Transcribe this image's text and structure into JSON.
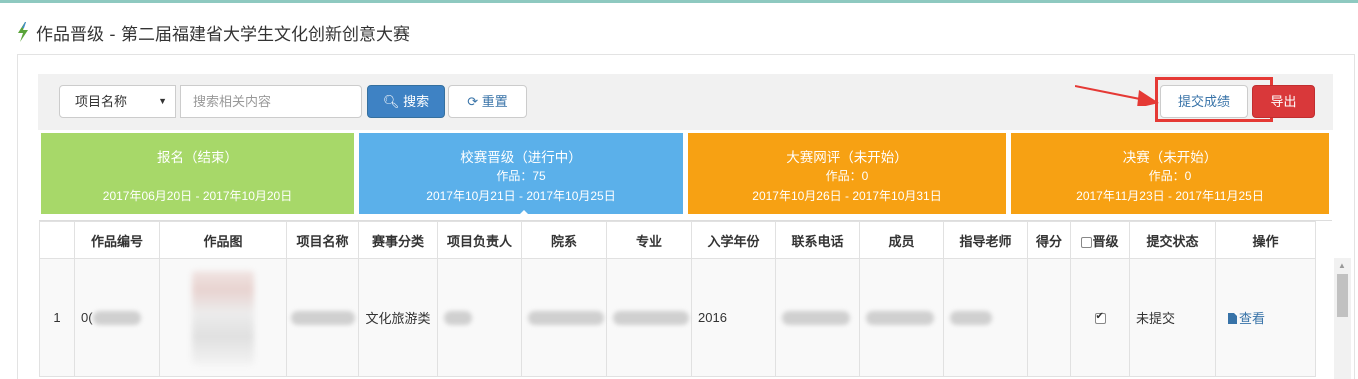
{
  "page": {
    "title": "作品晋级 - 第二届福建省大学生文化创新创意大赛"
  },
  "toolbar": {
    "select_value": "项目名称",
    "search_placeholder": "搜索相关内容",
    "search_label": "搜索",
    "reset_label": "重置",
    "submit_label": "提交成绩",
    "export_label": "导出"
  },
  "stages": [
    {
      "name": "报名（结束）",
      "count": "",
      "dates": "2017年06月20日 - 2017年10月20日",
      "color": "#a7d869"
    },
    {
      "name": "校赛晋级（进行中）",
      "count": "作品：75",
      "dates": "2017年10月21日 - 2017年10月25日",
      "color": "#5bb0ea"
    },
    {
      "name": "大赛网评（未开始）",
      "count": "作品：0",
      "dates": "2017年10月26日 - 2017年10月31日",
      "color": "#f7a113"
    },
    {
      "name": "决赛（未开始）",
      "count": "作品：0",
      "dates": "2017年11月23日 - 2017年11月25日",
      "color": "#f7a113"
    }
  ],
  "table": {
    "headers": [
      "",
      "作品编号",
      "作品图",
      "项目名称",
      "赛事分类",
      "项目负责人",
      "院系",
      "专业",
      "入学年份",
      "联系电话",
      "成员",
      "指导老师",
      "得分",
      "晋级",
      "提交状态",
      "操作"
    ],
    "rows": [
      {
        "index": "1",
        "code_prefix": "0(",
        "category": "文化旅游类",
        "year": "2016",
        "advance_checked": true,
        "status": "未提交",
        "action": "查看"
      }
    ]
  },
  "colors": {
    "accent": "#3e82c4",
    "danger": "#d9383a",
    "highlight": "#e53935"
  }
}
